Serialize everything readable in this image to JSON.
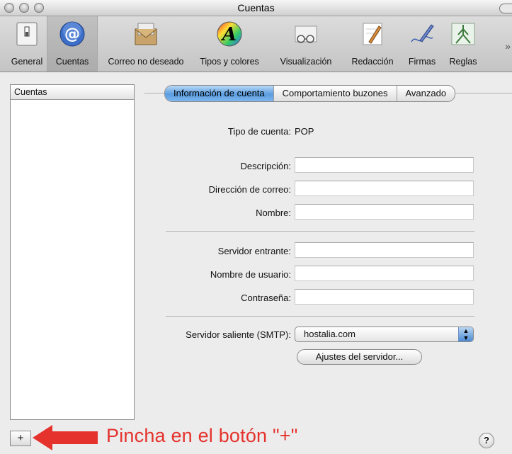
{
  "window": {
    "title": "Cuentas"
  },
  "toolbar": {
    "items": [
      {
        "label": "General",
        "icon": "switch-icon"
      },
      {
        "label": "Cuentas",
        "icon": "at-sign-icon"
      },
      {
        "label": "Correo no deseado",
        "icon": "junk-mail-icon"
      },
      {
        "label": "Tipos y colores",
        "icon": "font-color-icon"
      },
      {
        "label": "Visualización",
        "icon": "glasses-icon"
      },
      {
        "label": "Redacción",
        "icon": "pencil-icon"
      },
      {
        "label": "Firmas",
        "icon": "signature-pen-icon"
      },
      {
        "label": "Reglas",
        "icon": "rules-icon"
      }
    ],
    "overflow": "»"
  },
  "accounts": {
    "header": "Cuentas",
    "add_label": "+"
  },
  "tabs": [
    {
      "label": "Información de cuenta",
      "active": true
    },
    {
      "label": "Comportamiento buzones",
      "active": false
    },
    {
      "label": "Avanzado",
      "active": false
    }
  ],
  "form": {
    "account_type_label": "Tipo de cuenta:",
    "account_type_value": "POP",
    "description_label": "Descripción:",
    "description_value": "",
    "email_label": "Dirección de correo:",
    "email_value": "",
    "name_label": "Nombre:",
    "name_value": "",
    "incoming_label": "Servidor entrante:",
    "incoming_value": "",
    "username_label": "Nombre de usuario:",
    "username_value": "",
    "password_label": "Contraseña:",
    "password_value": "",
    "smtp_label": "Servidor saliente (SMTP):",
    "smtp_value": "hostalia.com",
    "server_settings_label": "Ajustes del servidor..."
  },
  "annotation": {
    "text": "Pincha en el botón \"+\"",
    "color": "#e5322d"
  },
  "help": {
    "label": "?"
  },
  "colors": {
    "accent": "#5b9de0",
    "annotation": "#e5322d"
  }
}
